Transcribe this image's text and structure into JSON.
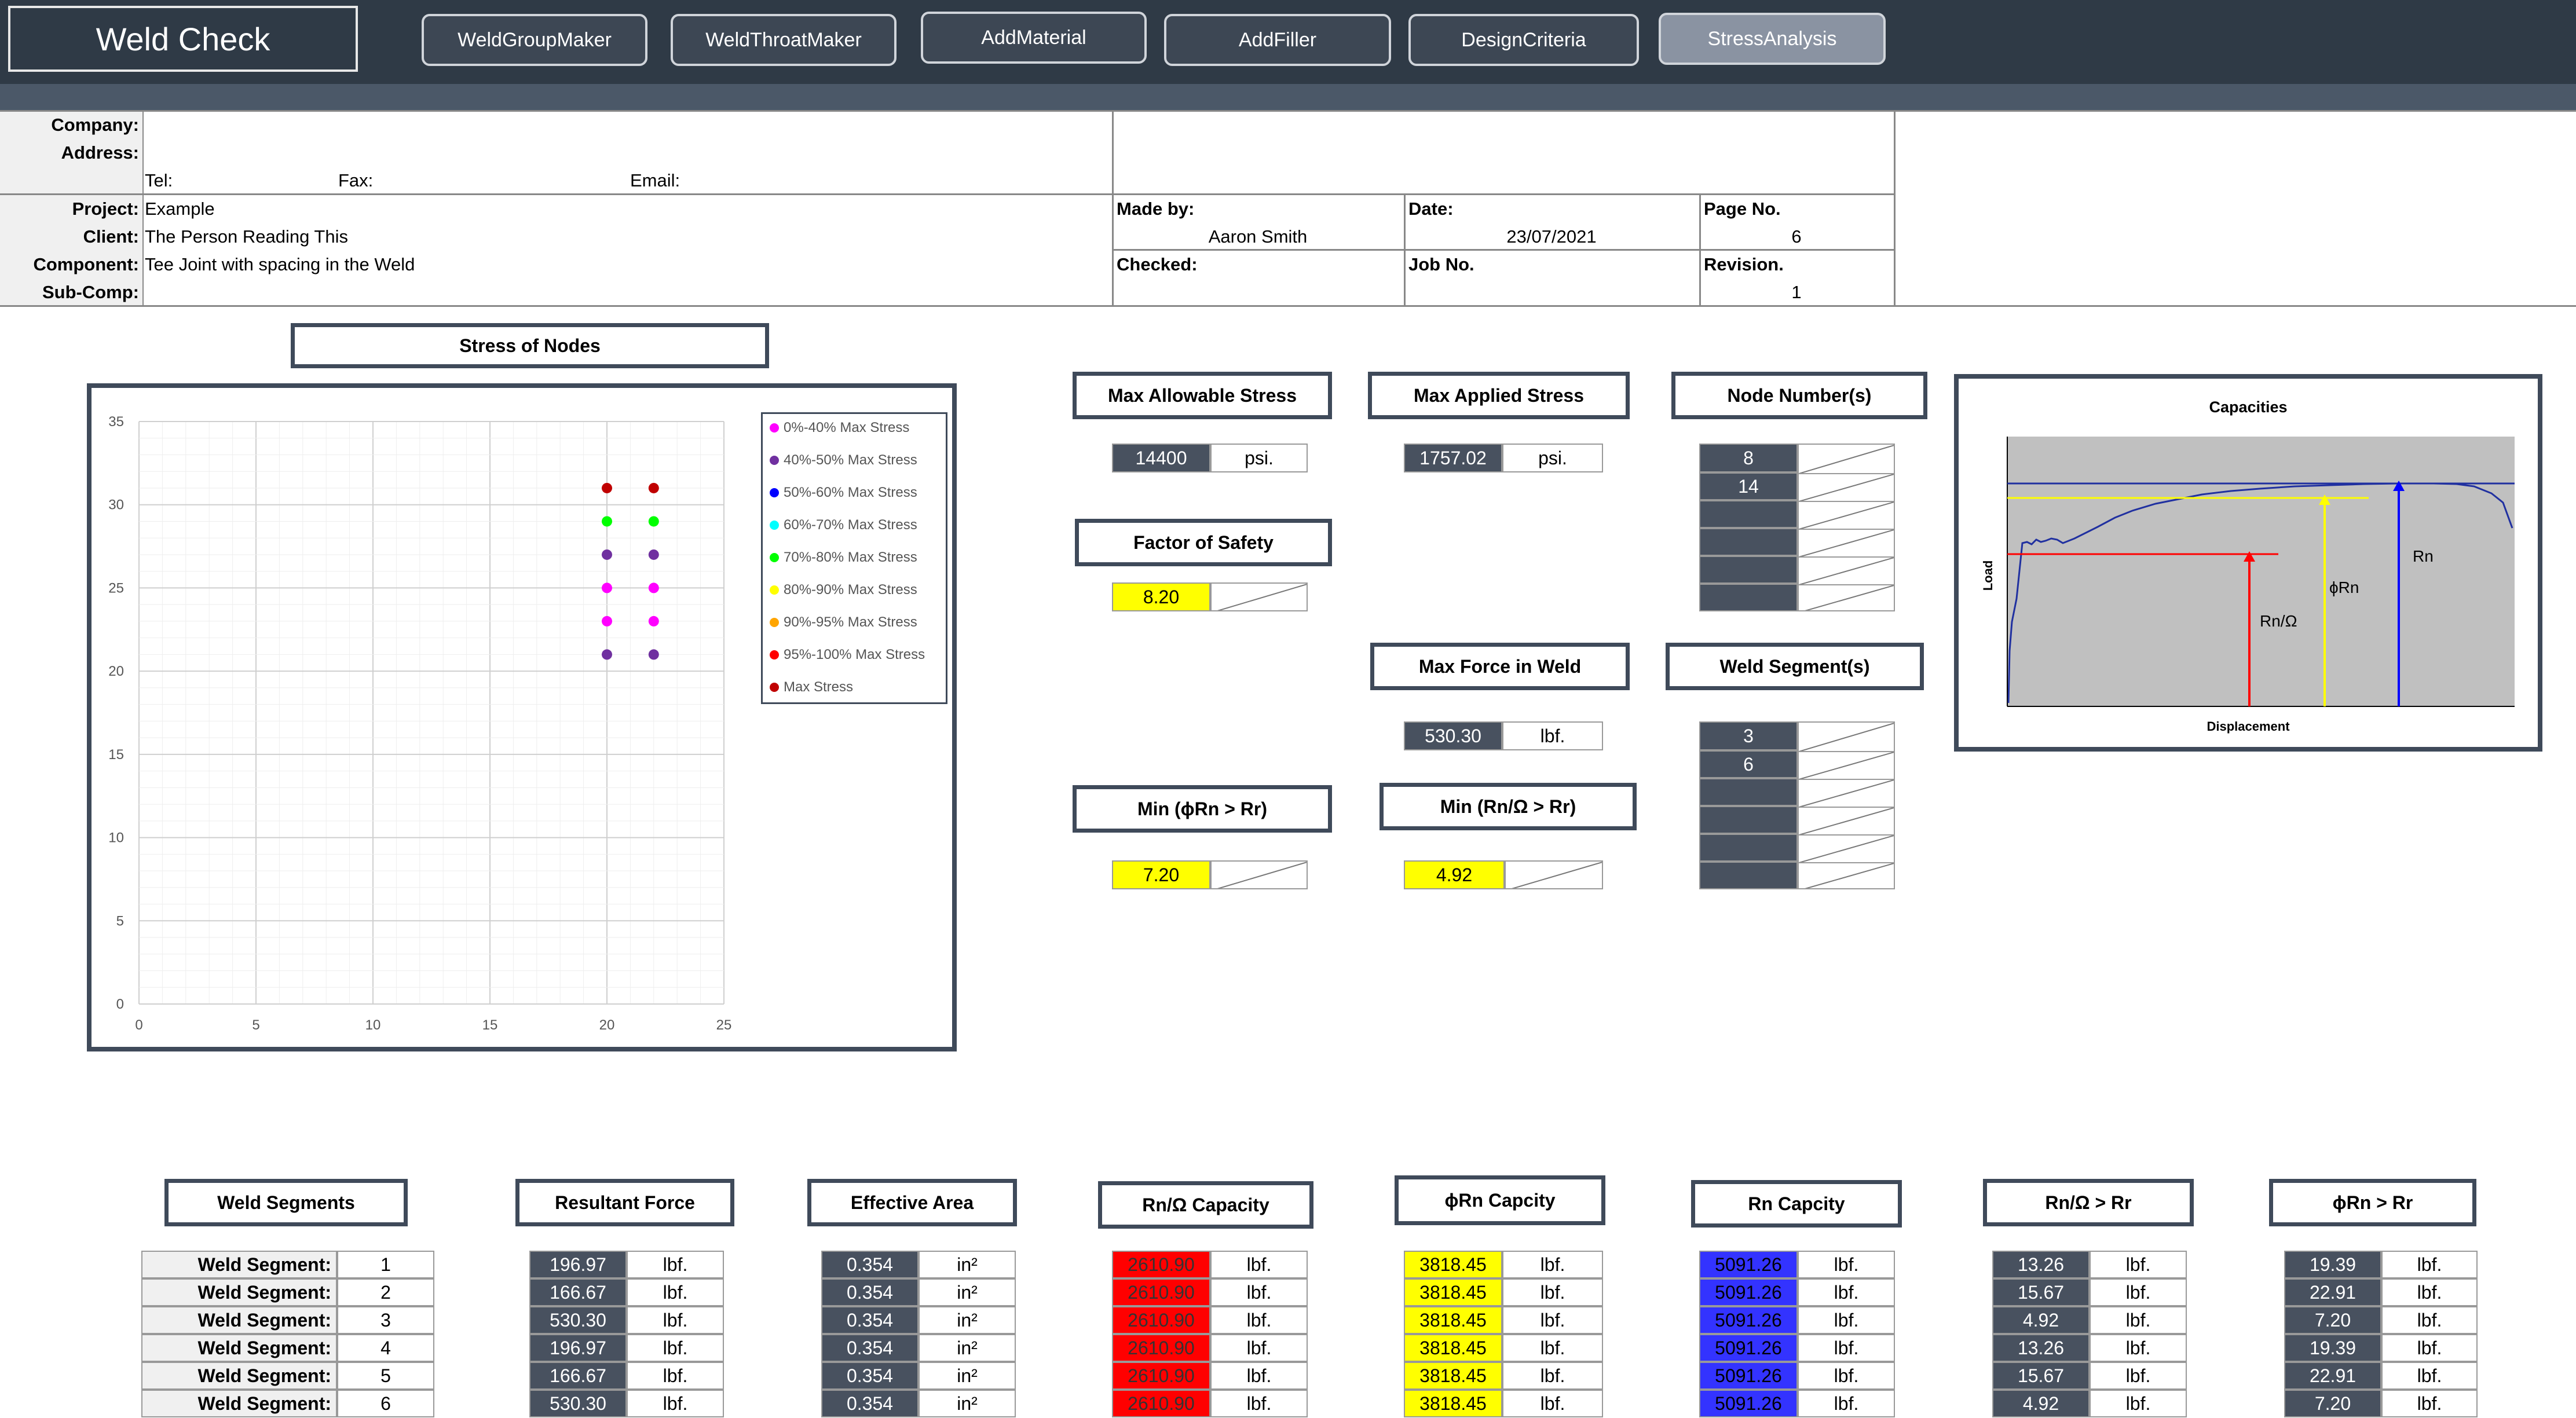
{
  "app": {
    "title": "Weld Check"
  },
  "nav": [
    {
      "label": "WeldGroupMaker"
    },
    {
      "label": "WeldThroatMaker"
    },
    {
      "label": "AddMaterial"
    },
    {
      "label": "AddFiller"
    },
    {
      "label": "DesignCriteria"
    },
    {
      "label": "StressAnalysis"
    }
  ],
  "header": {
    "company_label": "Company:",
    "address_label": "Address:",
    "tel_label": "Tel:",
    "fax_label": "Fax:",
    "email_label": "Email:",
    "project_label": "Project:",
    "project": "Example",
    "client_label": "Client:",
    "client": "The Person Reading This",
    "component_label": "Component:",
    "component": "Tee Joint with spacing in the Weld",
    "subcomp_label": "Sub-Comp:",
    "made_by_label": "Made by:",
    "made_by": "Aaron Smith",
    "date_label": "Date:",
    "date": "23/07/2021",
    "page_label": "Page No.",
    "page": "6",
    "checked_label": "Checked:",
    "job_label": "Job No.",
    "revision_label": "Revision.",
    "revision": "1"
  },
  "stress_chart": {
    "title": "Stress of Nodes",
    "legend": [
      {
        "label": "0%-40% Max Stress",
        "color": "#ff00ff"
      },
      {
        "label": "40%-50% Max Stress",
        "color": "#7030a0"
      },
      {
        "label": "50%-60% Max Stress",
        "color": "#0000ff"
      },
      {
        "label": "60%-70% Max Stress",
        "color": "#00ffff"
      },
      {
        "label": "70%-80% Max Stress",
        "color": "#00ff00"
      },
      {
        "label": "80%-90% Max Stress",
        "color": "#ffff00"
      },
      {
        "label": "90%-95% Max Stress",
        "color": "#ffa500"
      },
      {
        "label": "95%-100% Max Stress",
        "color": "#ff0000"
      },
      {
        "label": "Max Stress",
        "color": "#c00000"
      }
    ]
  },
  "chart_data": {
    "type": "scatter",
    "title": "Stress of Nodes",
    "xlim": [
      0,
      25
    ],
    "ylim": [
      0,
      35
    ],
    "xticks": [
      0,
      5,
      10,
      15,
      20,
      25
    ],
    "yticks": [
      0,
      5,
      10,
      15,
      20,
      25,
      30,
      35
    ],
    "grid": true,
    "legend_position": "top-right",
    "series": [
      {
        "name": "0%-40% Max Stress",
        "color": "#ff00ff",
        "points": [
          [
            20,
            25
          ],
          [
            22,
            25
          ],
          [
            20,
            23
          ],
          [
            22,
            23
          ]
        ]
      },
      {
        "name": "40%-50% Max Stress",
        "color": "#7030a0",
        "points": [
          [
            20,
            27
          ],
          [
            22,
            27
          ],
          [
            20,
            21
          ],
          [
            22,
            21
          ]
        ]
      },
      {
        "name": "70%-80% Max Stress",
        "color": "#00ff00",
        "points": [
          [
            20,
            29
          ],
          [
            22,
            29
          ]
        ]
      },
      {
        "name": "Max Stress",
        "color": "#c00000",
        "points": [
          [
            20,
            31
          ],
          [
            22,
            31
          ]
        ]
      }
    ]
  },
  "summary": {
    "max_allowable_title": "Max Allowable Stress",
    "max_allowable": "14400",
    "max_allowable_unit": "psi.",
    "max_applied_title": "Max Applied Stress",
    "max_applied": "1757.02",
    "max_applied_unit": "psi.",
    "node_numbers_title": "Node Number(s)",
    "node_numbers": [
      "8",
      "14",
      "",
      "",
      "",
      ""
    ],
    "factor_safety_title": "Factor of Safety",
    "factor_safety": "8.20",
    "max_force_title": "Max Force in Weld",
    "max_force": "530.30",
    "max_force_unit": "lbf.",
    "weld_segments_title": "Weld Segment(s)",
    "weld_segments": [
      "3",
      "6",
      "",
      "",
      "",
      ""
    ],
    "min_phi_title": "Min (ϕRn > Rr)",
    "min_phi": "7.20",
    "min_omega_title": "Min (Rn/Ω > Rr)",
    "min_omega": "4.92"
  },
  "capacities": {
    "title": "Capacities",
    "ylabel": "Load",
    "xlabel": "Displacement",
    "rn": "Rn",
    "phirn": "ϕRn",
    "rnomega": "Rn/Ω"
  },
  "table": {
    "headers": {
      "segments": "Weld Segments",
      "resultant": "Resultant Force",
      "area": "Effective Area",
      "rnomega": "Rn/Ω Capacity",
      "phirn": "ϕRn Capcity",
      "rn": "Rn Capcity",
      "check_omega": "Rn/Ω > Rr",
      "check_phi": "ϕRn > Rr"
    },
    "row_label": "Weld Segment:",
    "unit_lbf": "lbf.",
    "unit_in2": "in²",
    "rows": [
      {
        "seg": "1",
        "force": "196.97",
        "area": "0.354",
        "rnomega": "2610.90",
        "phirn": "3818.45",
        "rn": "5091.26",
        "c_omega": "13.26",
        "c_phi": "19.39"
      },
      {
        "seg": "2",
        "force": "166.67",
        "area": "0.354",
        "rnomega": "2610.90",
        "phirn": "3818.45",
        "rn": "5091.26",
        "c_omega": "15.67",
        "c_phi": "22.91"
      },
      {
        "seg": "3",
        "force": "530.30",
        "area": "0.354",
        "rnomega": "2610.90",
        "phirn": "3818.45",
        "rn": "5091.26",
        "c_omega": "4.92",
        "c_phi": "7.20"
      },
      {
        "seg": "4",
        "force": "196.97",
        "area": "0.354",
        "rnomega": "2610.90",
        "phirn": "3818.45",
        "rn": "5091.26",
        "c_omega": "13.26",
        "c_phi": "19.39"
      },
      {
        "seg": "5",
        "force": "166.67",
        "area": "0.354",
        "rnomega": "2610.90",
        "phirn": "3818.45",
        "rn": "5091.26",
        "c_omega": "15.67",
        "c_phi": "22.91"
      },
      {
        "seg": "6",
        "force": "530.30",
        "area": "0.354",
        "rnomega": "2610.90",
        "phirn": "3818.45",
        "rn": "5091.26",
        "c_omega": "4.92",
        "c_phi": "7.20"
      }
    ]
  }
}
